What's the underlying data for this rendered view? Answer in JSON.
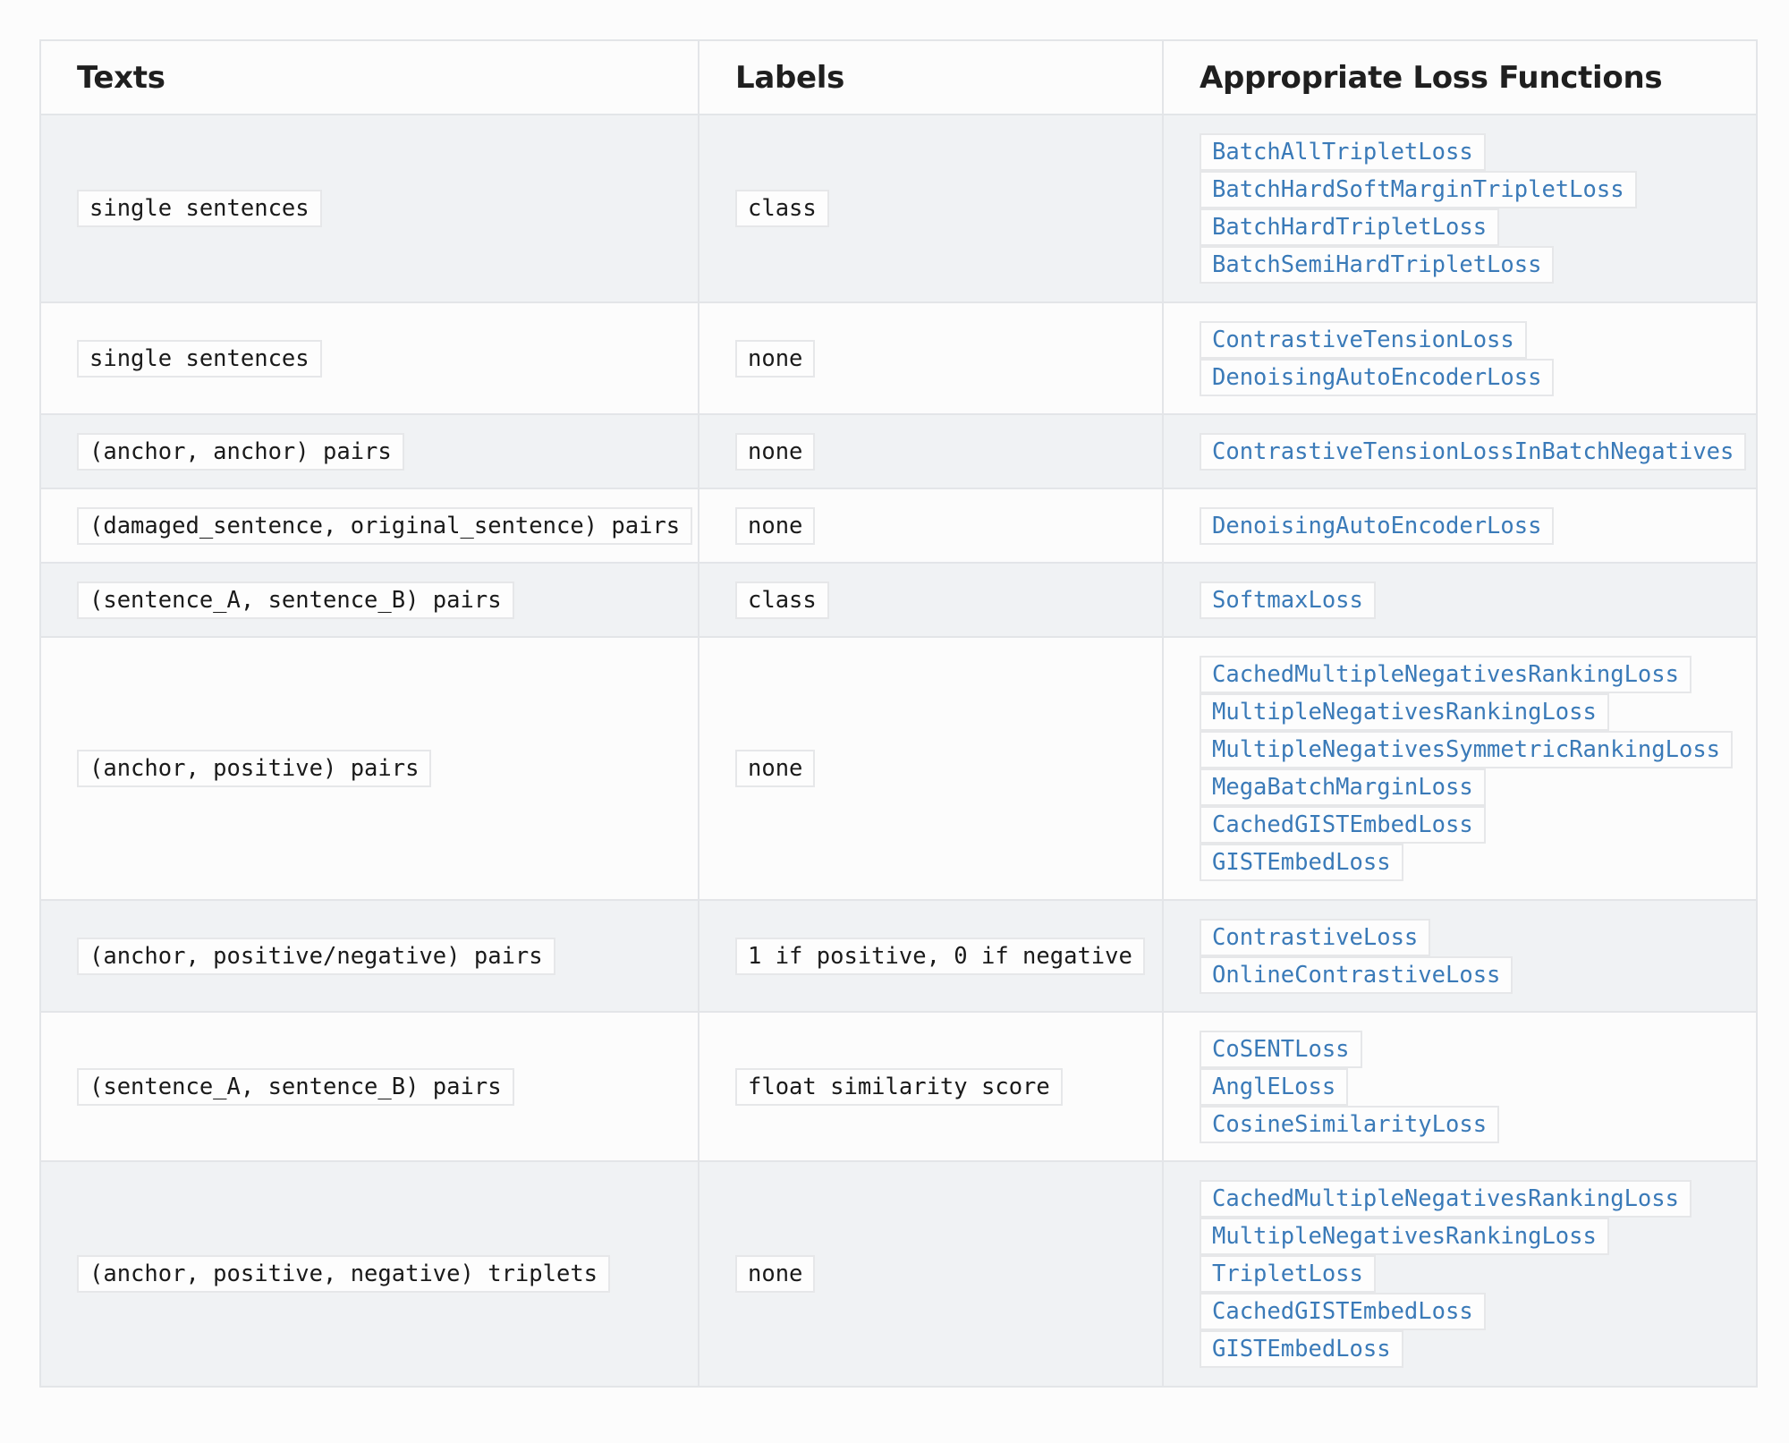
{
  "table": {
    "headers": {
      "texts": "Texts",
      "labels": "Labels",
      "losses": "Appropriate Loss Functions"
    },
    "rows": [
      {
        "texts": "single sentences",
        "labels": "class",
        "losses": [
          "BatchAllTripletLoss",
          "BatchHardSoftMarginTripletLoss",
          "BatchHardTripletLoss",
          "BatchSemiHardTripletLoss"
        ]
      },
      {
        "texts": "single sentences",
        "labels": "none",
        "losses": [
          "ContrastiveTensionLoss",
          "DenoisingAutoEncoderLoss"
        ]
      },
      {
        "texts": "(anchor, anchor) pairs",
        "labels": "none",
        "losses": [
          "ContrastiveTensionLossInBatchNegatives"
        ]
      },
      {
        "texts": "(damaged_sentence, original_sentence) pairs",
        "labels": "none",
        "losses": [
          "DenoisingAutoEncoderLoss"
        ]
      },
      {
        "texts": "(sentence_A, sentence_B) pairs",
        "labels": "class",
        "losses": [
          "SoftmaxLoss"
        ]
      },
      {
        "texts": "(anchor, positive) pairs",
        "labels": "none",
        "losses": [
          "CachedMultipleNegativesRankingLoss",
          "MultipleNegativesRankingLoss",
          "MultipleNegativesSymmetricRankingLoss",
          "MegaBatchMarginLoss",
          "CachedGISTEmbedLoss",
          "GISTEmbedLoss"
        ]
      },
      {
        "texts": "(anchor, positive/negative) pairs",
        "labels": "1 if positive, 0 if negative",
        "losses": [
          "ContrastiveLoss",
          "OnlineContrastiveLoss"
        ]
      },
      {
        "texts": "(sentence_A, sentence_B) pairs",
        "labels": "float similarity score",
        "losses": [
          "CoSENTLoss",
          "AnglELoss",
          "CosineSimilarityLoss"
        ]
      },
      {
        "texts": "(anchor, positive, negative) triplets",
        "labels": "none",
        "losses": [
          "CachedMultipleNegativesRankingLoss",
          "MultipleNegativesRankingLoss",
          "TripletLoss",
          "CachedGISTEmbedLoss",
          "GISTEmbedLoss"
        ]
      }
    ]
  }
}
